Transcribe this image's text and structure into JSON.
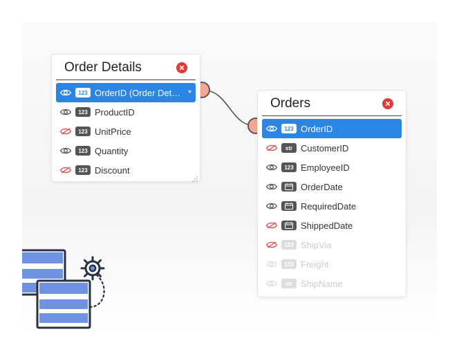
{
  "colors": {
    "accent": "#2b85e4",
    "danger": "#e53935",
    "node": "#f8a594",
    "artBlue": "#6f93e0"
  },
  "tables": {
    "orderDetails": {
      "title": "Order Details",
      "fields": [
        {
          "label": "OrderID (Order Det…",
          "type": "123",
          "visible": true,
          "selected": true,
          "starred": true
        },
        {
          "label": "ProductID",
          "type": "123",
          "visible": true,
          "selected": false
        },
        {
          "label": "UnitPrice",
          "type": "123",
          "visible": false,
          "selected": false
        },
        {
          "label": "Quantity",
          "type": "123",
          "visible": true,
          "selected": false
        },
        {
          "label": "Discount",
          "type": "123",
          "visible": false,
          "selected": false
        }
      ]
    },
    "orders": {
      "title": "Orders",
      "fields": [
        {
          "label": "OrderID",
          "type": "123",
          "visible": true,
          "selected": true
        },
        {
          "label": "CustomerID",
          "type": "str",
          "visible": false,
          "selected": false
        },
        {
          "label": "EmployeeID",
          "type": "123",
          "visible": true,
          "selected": false
        },
        {
          "label": "OrderDate",
          "type": "date",
          "visible": true,
          "selected": false
        },
        {
          "label": "RequiredDate",
          "type": "date",
          "visible": true,
          "selected": false
        },
        {
          "label": "ShippedDate",
          "type": "date",
          "visible": false,
          "selected": false
        },
        {
          "label": "ShipVia",
          "type": "123",
          "visible": false,
          "selected": false,
          "faded": true
        },
        {
          "label": "Freight",
          "type": "123",
          "visible": true,
          "selected": false,
          "faded": true
        },
        {
          "label": "ShipName",
          "type": "str",
          "visible": true,
          "selected": false,
          "faded": true
        }
      ]
    }
  }
}
